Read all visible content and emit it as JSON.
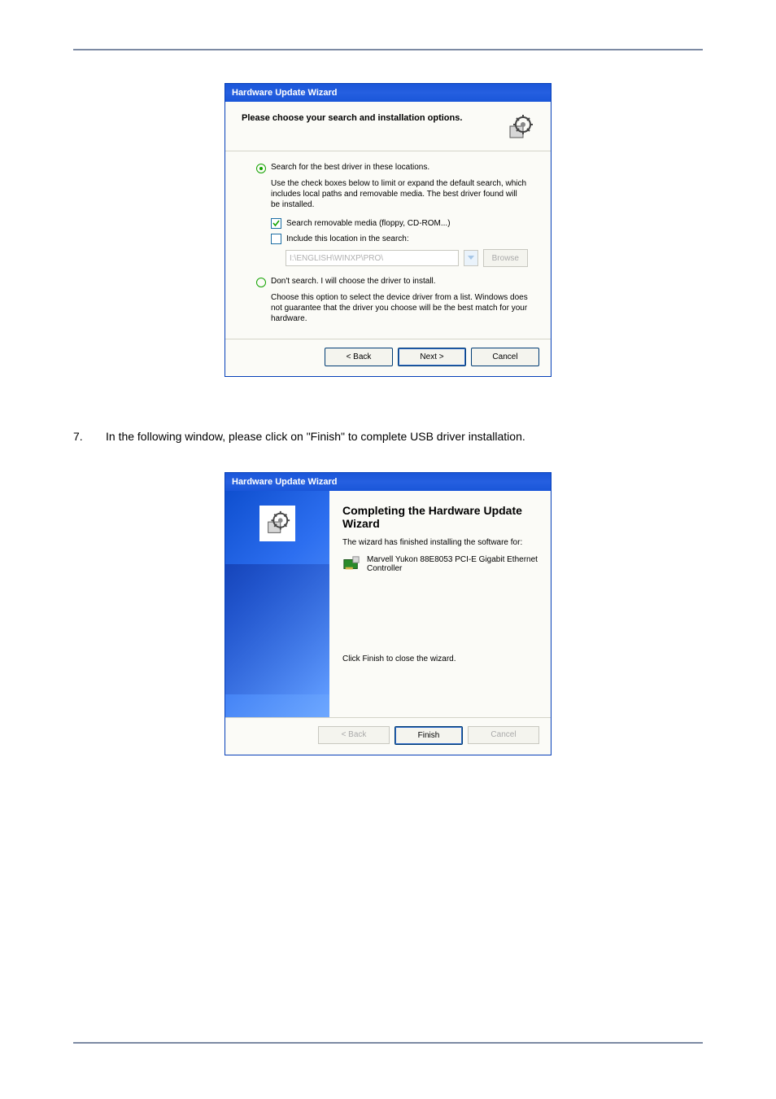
{
  "wizard1": {
    "titlebar": "Hardware Update Wizard",
    "heading": "Please choose your search and installation options.",
    "radio1": "Search for the best driver in these locations.",
    "desc1": "Use the check boxes below to limit or expand the default search, which includes local paths and removable media. The best driver found will be installed.",
    "check1": "Search removable media (floppy, CD-ROM...)",
    "check2": "Include this location in the search:",
    "path_value": "I:\\ENGLISH\\WINXP\\PRO\\",
    "browse": "Browse",
    "radio2": "Don't search. I will choose the driver to install.",
    "desc2": "Choose this option to select the device driver from a list.  Windows does not guarantee that the driver you choose will be the best match for your hardware.",
    "back": "< Back",
    "next": "Next >",
    "cancel": "Cancel"
  },
  "step": {
    "num": "7.",
    "text": "In the following window, please click on \"Finish\" to complete USB driver installation."
  },
  "wizard2": {
    "titlebar": "Hardware Update Wizard",
    "heading": "Completing the Hardware Update Wizard",
    "sub": "The wizard has finished installing the software for:",
    "device": "Marvell Yukon 88E8053 PCI-E Gigabit Ethernet Controller",
    "close_hint": "Click Finish to close the wizard.",
    "back": "< Back",
    "finish": "Finish",
    "cancel": "Cancel"
  }
}
